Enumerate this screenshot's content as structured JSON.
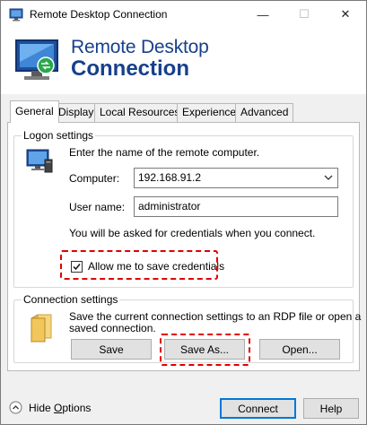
{
  "window": {
    "title": "Remote Desktop Connection"
  },
  "titlebar": {
    "minimize_glyph": "—",
    "maximize_glyph": "☐",
    "close_glyph": "✕"
  },
  "banner": {
    "line1": "Remote Desktop",
    "line2": "Connection"
  },
  "tabs": [
    {
      "label": "General",
      "selected": true
    },
    {
      "label": "Display",
      "selected": false
    },
    {
      "label": "Local Resources",
      "selected": false
    },
    {
      "label": "Experience",
      "selected": false
    },
    {
      "label": "Advanced",
      "selected": false
    }
  ],
  "logon": {
    "group_label": "Logon settings",
    "instruction": "Enter the name of the remote computer.",
    "computer_label": "Computer:",
    "computer_value": "192.168.91.2",
    "username_label": "User name:",
    "username_value": "administrator",
    "credentials_note": "You will be asked for credentials when you connect.",
    "save_credentials_label": "Allow me to save credentials",
    "save_credentials_checked": true
  },
  "connection": {
    "group_label": "Connection settings",
    "description_line1": "Save the current connection settings to an RDP file or open a",
    "description_line2": "saved connection.",
    "save_label": "Save",
    "save_as_label": "Save As...",
    "open_label": "Open..."
  },
  "footer": {
    "hide_options_label": "Hide Options",
    "connect_label": "Connect",
    "help_label": "Help"
  },
  "colors": {
    "banner_text": "#17408b",
    "highlight": "#e00000",
    "default_button_border": "#0078d7"
  }
}
